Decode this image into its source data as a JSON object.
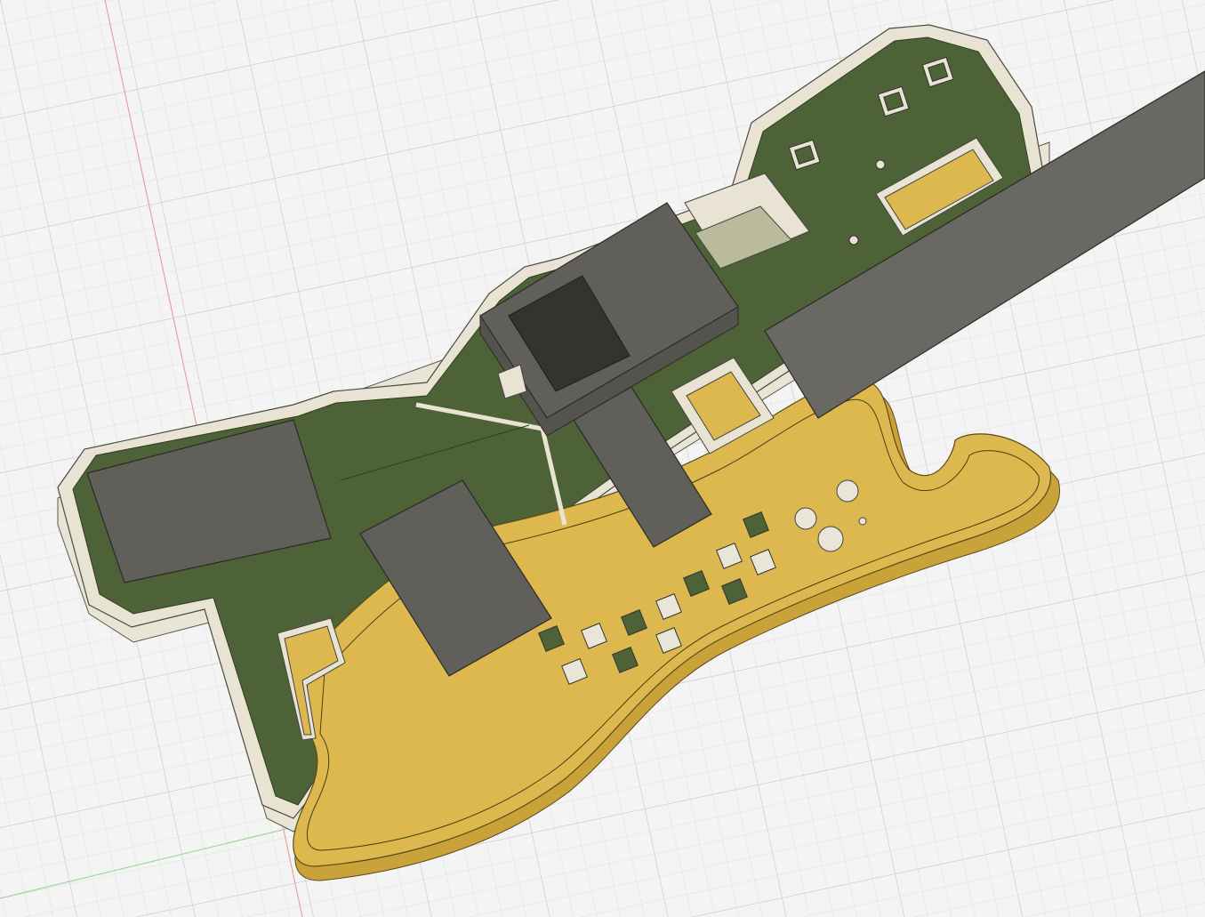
{
  "app": {
    "view": "3d-viewport",
    "background_color": "#f4f4f4",
    "grid_minor_color": "#e0e0e0",
    "grid_major_color": "#cfcfcf",
    "axis_red_color": "#e8a0a0",
    "axis_green_color": "#9fd79f"
  },
  "model": {
    "pcb_green_color": "#4d6236",
    "pcb_dark_color": "#3a4a28",
    "bevel_color": "#e8e2d2",
    "side_color": "#f3f0e6",
    "gold_color": "#dcb84e",
    "gold_side_color": "#c9a33a",
    "component_gray_color": "#615f5a",
    "component_dark_color": "#35332f",
    "display_glass_color": "#b9bb9c",
    "pad_white_color": "#e9e5d8"
  },
  "components": [
    "neck-bar",
    "lcd-module",
    "lcd-screen",
    "glass-window",
    "left-module",
    "center-module",
    "right-module",
    "gold-pad-top",
    "gold-pad-center",
    "gold-pad-left",
    "push-button",
    "pad-grid"
  ]
}
